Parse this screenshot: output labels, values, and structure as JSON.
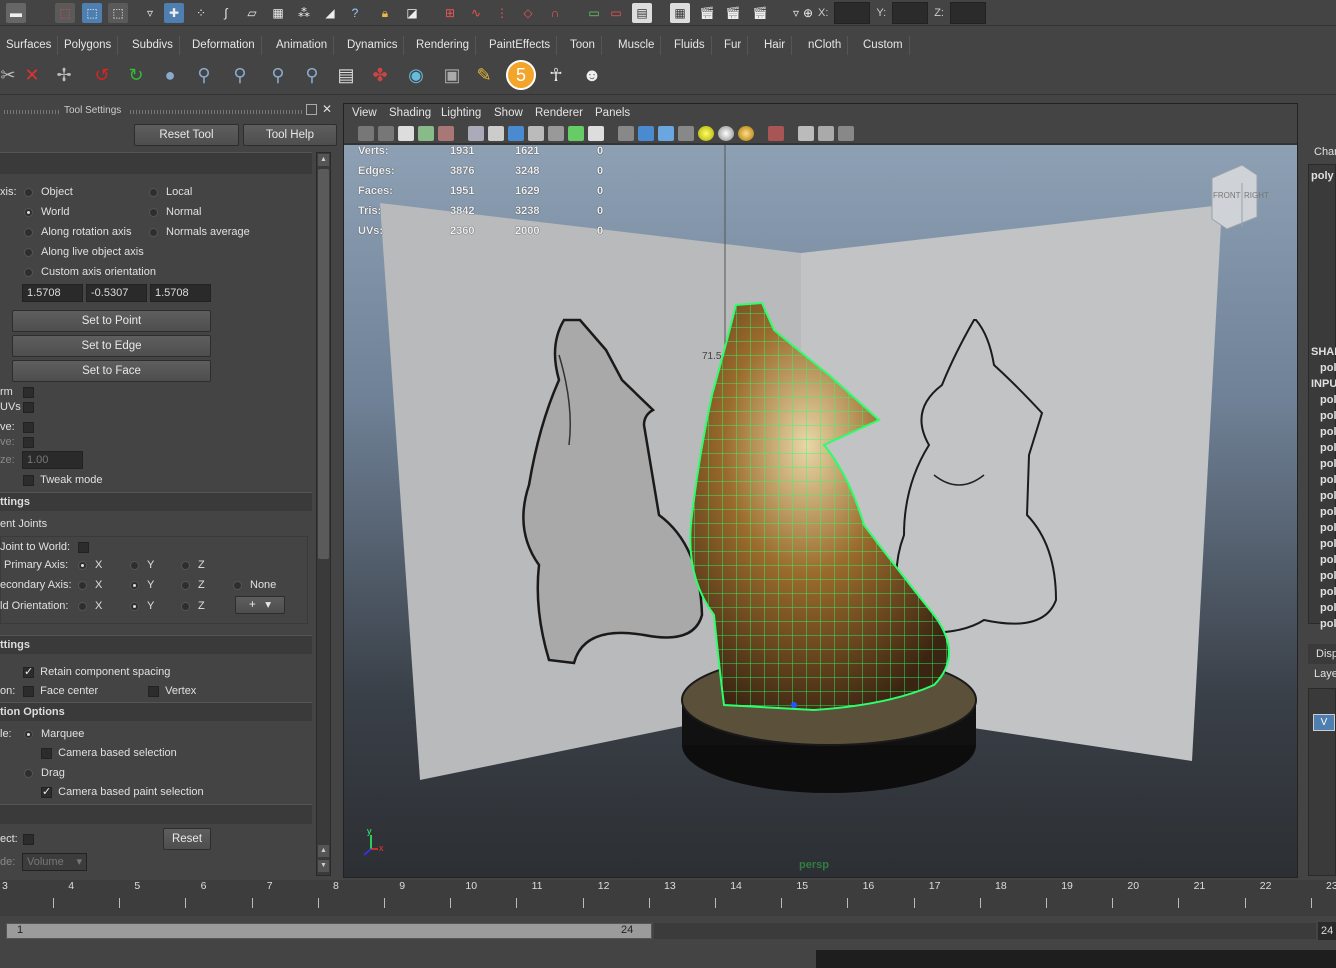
{
  "coords": {
    "x_label": "X:",
    "y_label": "Y:",
    "z_label": "Z:"
  },
  "shelf_tabs": [
    "Surfaces",
    "Polygons",
    "Subdivs",
    "Deformation",
    "Animation",
    "Dynamics",
    "Rendering",
    "PaintEffects",
    "Toon",
    "Muscle",
    "Fluids",
    "Fur",
    "Hair",
    "nCloth",
    "Custom"
  ],
  "tool_settings": {
    "title": "Tool Settings",
    "reset_tool": "Reset Tool",
    "tool_help": "Tool Help",
    "axis_label": "xis:",
    "axis_options": {
      "object": "Object",
      "local": "Local",
      "world": "World",
      "normal": "Normal",
      "along_rotation": "Along rotation axis",
      "normals_average": "Normals average",
      "along_live": "Along live object axis",
      "custom": "Custom axis orientation"
    },
    "orient_values": [
      "1.5708",
      "-0.5307",
      "1.5708"
    ],
    "set_to_point": "Set to Point",
    "set_to_edge": "Set to Edge",
    "set_to_face": "Set to Face",
    "rm_label": "rm",
    "uvs_label": "UVs",
    "ve1": "ve:",
    "ve2": "ve:",
    "ze_label": "ze:",
    "ze_value": "1.00",
    "tweak_mode": "Tweak mode",
    "sec_settings1": "ttings",
    "joints_label": "ent Joints",
    "joint_to_world": "Joint to World:",
    "primary_axis": "Primary Axis:",
    "secondary_axis": "econdary Axis:",
    "world_orientation": "ld Orientation:",
    "axis_x": "X",
    "axis_y": "Y",
    "axis_z": "Z",
    "axis_none": "None",
    "plus": "+",
    "sec_settings2": "ttings",
    "retain_spacing": "Retain component spacing",
    "on_label": "on:",
    "face_center": "Face center",
    "vertex": "Vertex",
    "sec_selection": "tion Options",
    "le_label": "le:",
    "marquee": "Marquee",
    "camera_based": "Camera based selection",
    "drag": "Drag",
    "camera_paint": "Camera based paint selection",
    "ect_label": "ect:",
    "reset": "Reset",
    "de_label": "de:",
    "volume": "Volume"
  },
  "viewport": {
    "menu": [
      "View",
      "Shading",
      "Lighting",
      "Show",
      "Renderer",
      "Panels"
    ],
    "hud": [
      {
        "label": "Verts:",
        "a": "1931",
        "b": "1621",
        "c": "0"
      },
      {
        "label": "Edges:",
        "a": "3876",
        "b": "3248",
        "c": "0"
      },
      {
        "label": "Faces:",
        "a": "1951",
        "b": "1629",
        "c": "0"
      },
      {
        "label": "Tris:",
        "a": "3842",
        "b": "3238",
        "c": "0"
      },
      {
        "label": "UVs:",
        "a": "2360",
        "b": "2000",
        "c": "0"
      }
    ],
    "camera": "persp",
    "cube_front": "FRONT",
    "cube_right": "RIGHT",
    "axis_y": "y",
    "axis_x": "x",
    "measure": "71.5"
  },
  "channel_box": {
    "header": "Char",
    "object": "poly",
    "shapes": "SHAP",
    "inputs": "INPU",
    "input_items": [
      "pol",
      "pol",
      "pol",
      "pol",
      "pol",
      "pol",
      "pol",
      "pol",
      "pol",
      "pol",
      "pol",
      "pol",
      "pol",
      "pol",
      "pol"
    ],
    "shape_item": "pol",
    "disp": "Disp",
    "layers": "Laye",
    "v": "V"
  },
  "timeline": {
    "ticks": [
      "3",
      "4",
      "5",
      "6",
      "7",
      "8",
      "9",
      "10",
      "11",
      "12",
      "13",
      "14",
      "15",
      "16",
      "17",
      "18",
      "19",
      "20",
      "21",
      "22",
      "23"
    ],
    "range_start": "1",
    "range_end": "24",
    "end_value": "24"
  },
  "colors": {
    "wireframe": "#2bff6b",
    "accent": "#2f7f42"
  }
}
